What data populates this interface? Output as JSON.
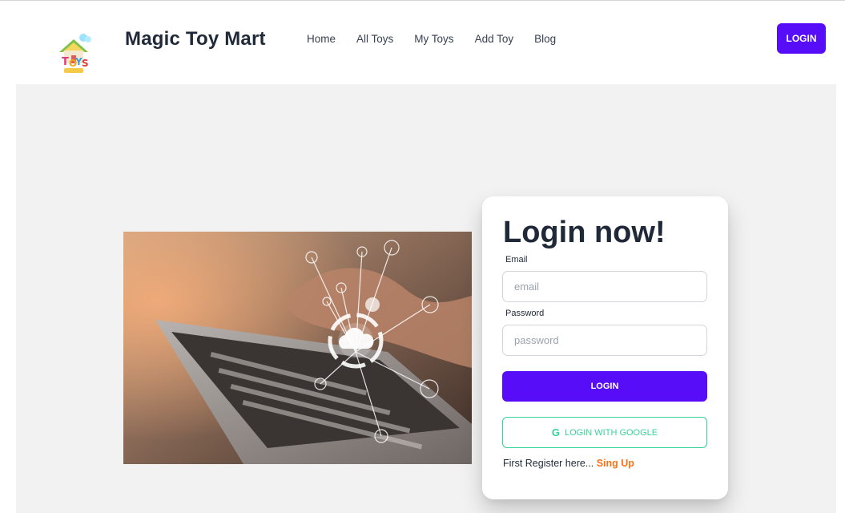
{
  "brand": {
    "name": "Magic Toy Mart",
    "logo_icon": "toys-house-logo"
  },
  "nav": {
    "links": [
      {
        "label": "Home"
      },
      {
        "label": "All Toys"
      },
      {
        "label": "My Toys"
      },
      {
        "label": "Add Toy"
      },
      {
        "label": "Blog"
      }
    ],
    "login_label": "LOGIN"
  },
  "login": {
    "title": "Login now!",
    "email_label": "Email",
    "email_placeholder": "email",
    "password_label": "Password",
    "password_placeholder": "password",
    "submit_label": "LOGIN",
    "google_label": "LOGIN WITH GOOGLE",
    "google_icon": "google-icon",
    "register_text": "First Register here...",
    "signup_label": "Sing Up"
  },
  "colors": {
    "primary": "#570df8",
    "accent": "#36d399",
    "link": "#f97316",
    "hero_bg": "#f2f2f2"
  }
}
